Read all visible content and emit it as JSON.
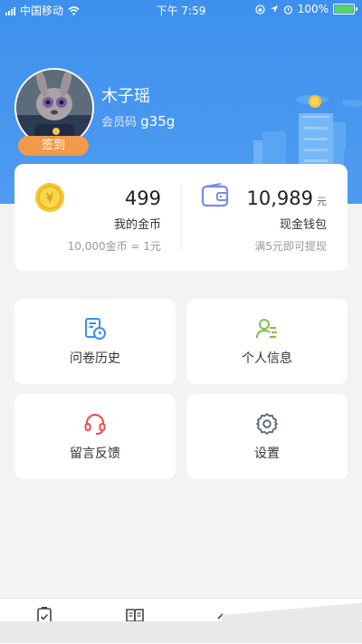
{
  "status_bar": {
    "carrier": "中国移动",
    "time": "下午 7:59",
    "battery": "100%"
  },
  "profile": {
    "name": "木子瑶",
    "member_label": "会员码",
    "member_code": "g35g",
    "checkin_label": "签到"
  },
  "wallet": {
    "coins": {
      "value": "499",
      "label": "我的金币",
      "note": "10,000金币 = 1元"
    },
    "cash": {
      "value": "10,989",
      "unit": "元",
      "label": "现金钱包",
      "note": "满5元即可提现"
    }
  },
  "menu": [
    {
      "label": "问卷历史",
      "icon": "survey-history-icon",
      "color": "#3d8ff0"
    },
    {
      "label": "个人信息",
      "icon": "user-info-icon",
      "color": "#7cc04c"
    },
    {
      "label": "留言反馈",
      "icon": "headset-icon",
      "color": "#ee4b4b"
    },
    {
      "label": "设置",
      "icon": "gear-icon",
      "color": "#5a6474"
    }
  ],
  "colors": {
    "header_blue": "#3d90ee",
    "checkin_orange": "#f2994a",
    "coin_gold": "#f7c531"
  }
}
